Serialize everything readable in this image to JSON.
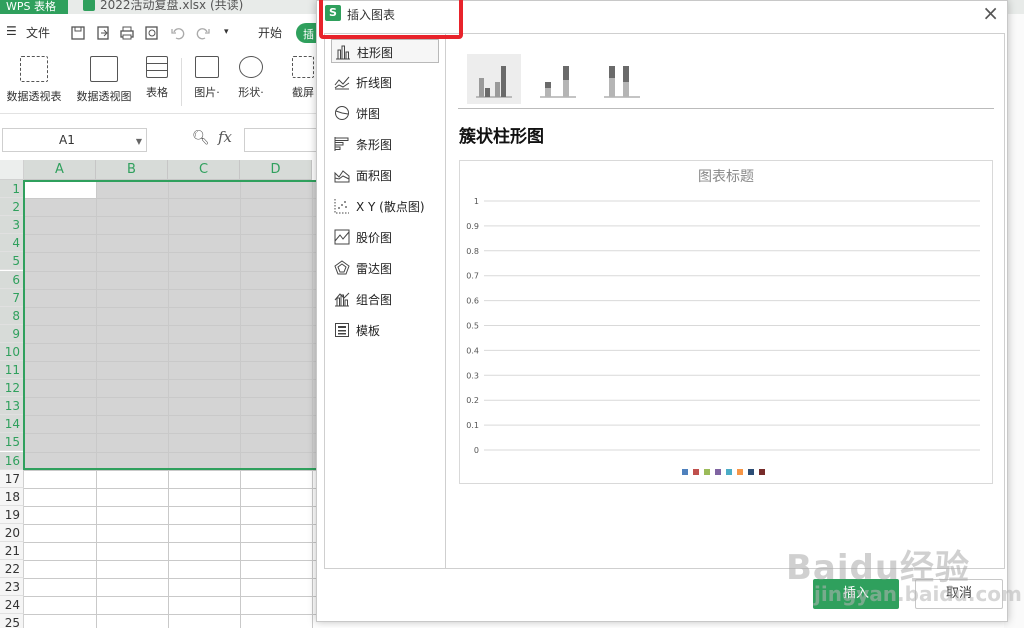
{
  "app": {
    "app_tab": "WPS 表格",
    "doc_tab": "2022活动复盘.xlsx (共读)"
  },
  "menubar": {
    "menu_label": "文件",
    "start_tab": "开始",
    "insert_tab_partial": "插"
  },
  "ribbon": {
    "items": [
      {
        "label": "数据透视表"
      },
      {
        "label": "数据透视图"
      },
      {
        "label": "表格"
      },
      {
        "label": "图片·"
      },
      {
        "label": "形状·"
      },
      {
        "label": "截屏"
      }
    ]
  },
  "formula_bar": {
    "name_box": "A1",
    "fx": "fx"
  },
  "grid": {
    "columns": [
      "A",
      "B",
      "C",
      "D"
    ],
    "rows": [
      "1",
      "2",
      "3",
      "4",
      "5",
      "6",
      "7",
      "8",
      "9",
      "10",
      "11",
      "12",
      "13",
      "14",
      "15",
      "16",
      "17",
      "18",
      "19",
      "20",
      "21",
      "22",
      "23",
      "24",
      "25"
    ]
  },
  "dialog": {
    "title": "插入图表",
    "close": "×",
    "chart_types": [
      {
        "label": "柱形图",
        "icon": "column-chart-icon"
      },
      {
        "label": "折线图",
        "icon": "line-chart-icon"
      },
      {
        "label": "饼图",
        "icon": "pie-chart-icon"
      },
      {
        "label": "条形图",
        "icon": "bar-chart-icon"
      },
      {
        "label": "面积图",
        "icon": "area-chart-icon"
      },
      {
        "label": "X Y (散点图)",
        "icon": "scatter-chart-icon"
      },
      {
        "label": "股价图",
        "icon": "stock-chart-icon"
      },
      {
        "label": "雷达图",
        "icon": "radar-chart-icon"
      },
      {
        "label": "组合图",
        "icon": "combo-chart-icon"
      },
      {
        "label": "模板",
        "icon": "template-icon"
      }
    ],
    "selected_subtype": "簇状柱形图",
    "insert_button": "插入",
    "cancel_button": "取消"
  },
  "chart_data": {
    "type": "bar",
    "title": "图表标题",
    "categories": [],
    "series": [],
    "ylim": [
      0,
      1
    ],
    "yticks": [
      "0",
      "0.1",
      "0.2",
      "0.3",
      "0.4",
      "0.5",
      "0.6",
      "0.7",
      "0.8",
      "0.9",
      "1"
    ],
    "grid": true,
    "legend_placement": "bottom",
    "legend_colors": [
      "#4f81bd",
      "#c0504d",
      "#9bbb59",
      "#8064a2",
      "#4bacc6",
      "#f79646",
      "#2c4d75",
      "#772c2a"
    ]
  },
  "watermark": {
    "line1": "Baidu经验",
    "line2": "jingyan.baidu.com"
  },
  "colors": {
    "accent": "#2fa05d",
    "highlight": "#e8232b"
  }
}
